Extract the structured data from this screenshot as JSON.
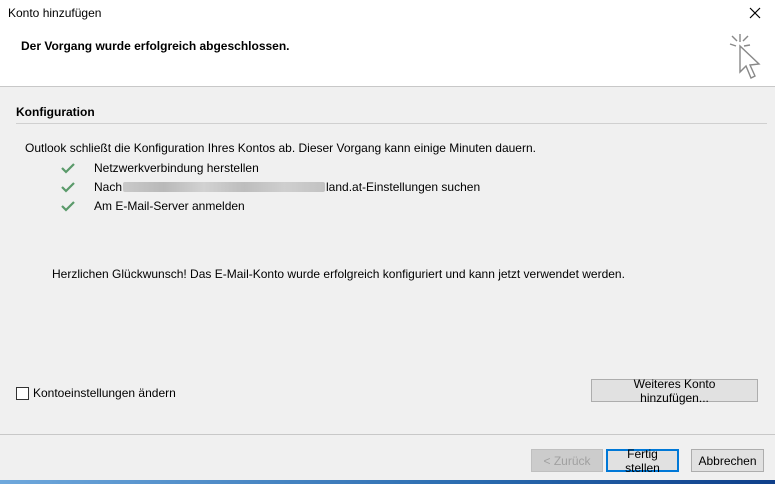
{
  "window": {
    "title": "Konto hinzufügen",
    "close_icon": "close-icon"
  },
  "header": {
    "headline": "Der Vorgang wurde erfolgreich abgeschlossen.",
    "icon": "cursor-sparkle-icon"
  },
  "section": {
    "title": "Konfiguration",
    "intro": "Outlook schließt die Konfiguration Ihres Kontos ab. Dieser Vorgang kann einige Minuten dauern.",
    "steps": [
      {
        "status": "done",
        "label": "Netzwerkverbindung herstellen"
      },
      {
        "status": "done",
        "prefix": "Nach",
        "suffix": "land.at-Einstellungen suchen"
      },
      {
        "status": "done",
        "label": "Am E-Mail-Server anmelden"
      }
    ],
    "congratulations": "Herzlichen Glückwunsch! Das E-Mail-Konto wurde erfolgreich konfiguriert und kann jetzt verwendet werden.",
    "change_settings_label": "Kontoeinstellungen ändern",
    "change_settings_checked": false,
    "add_another_label": "Weiteres Konto hinzufügen..."
  },
  "footer": {
    "back_label": "< Zurück",
    "finish_label": "Fertig stellen",
    "cancel_label": "Abbrechen"
  },
  "colors": {
    "check_green": "#5a9a6a",
    "focus_border": "#0078d7",
    "background": "#f0f0f0"
  }
}
